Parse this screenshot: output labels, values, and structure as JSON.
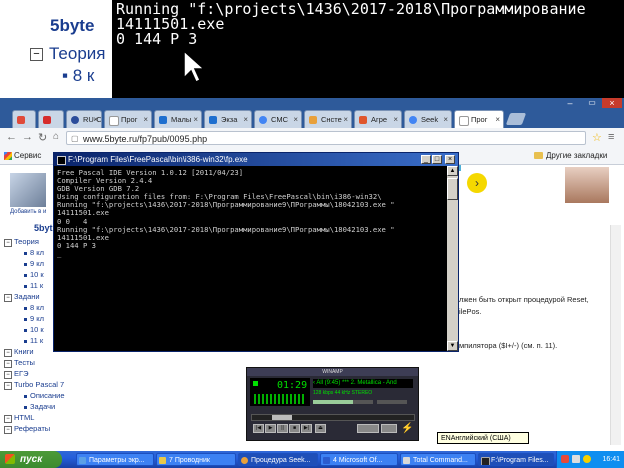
{
  "background": {
    "site_logo": "5byte",
    "tree_item": "Теория",
    "tree_sub": "8 к",
    "console_lines": [
      "Running \"f:\\projects\\1436\\2017-2018\\Программирование",
      "14111501.exe",
      "0 144 P 3"
    ]
  },
  "browser": {
    "tabs": [
      {
        "label": "",
        "color": "#e04a3a"
      },
      {
        "label": "",
        "color": "#d62c2c"
      },
      {
        "label": "RU-C",
        "color": "#2b4c9a"
      },
      {
        "label": "Прог",
        "color": "#ffffff"
      },
      {
        "label": "Малы",
        "color": "#1e6fcf"
      },
      {
        "label": "Экза",
        "color": "#1e6fcf"
      },
      {
        "label": "CMC",
        "color": "#4285f4"
      },
      {
        "label": "Снсте",
        "color": "#e8a03a"
      },
      {
        "label": "Агре",
        "color": "#e0562c"
      },
      {
        "label": "Seek",
        "color": "#4285f4"
      },
      {
        "label": "Прог",
        "color": "#ffffff"
      }
    ],
    "url": "www.5byte.ru/fp7pub/0095.php",
    "bookmarks_left": "Сервис",
    "bookmarks_right": "Другие закладки"
  },
  "sidebar": {
    "add_to_favorites": "Добавить в и",
    "logo": "5byt",
    "items": [
      {
        "label": "Теория",
        "type": "group"
      },
      {
        "label": "8 кл",
        "type": "sub"
      },
      {
        "label": "9 кл",
        "type": "sub"
      },
      {
        "label": "10 к",
        "type": "sub"
      },
      {
        "label": "11 к",
        "type": "sub"
      },
      {
        "label": "Задани",
        "type": "group"
      },
      {
        "label": "8 кл",
        "type": "sub"
      },
      {
        "label": "9 кл",
        "type": "sub"
      },
      {
        "label": "10 к",
        "type": "sub"
      },
      {
        "label": "11 к",
        "type": "sub"
      },
      {
        "label": "Книги",
        "type": "group"
      },
      {
        "label": "Тесты",
        "type": "group"
      },
      {
        "label": "ЕГЭ",
        "type": "group"
      },
      {
        "label": "Turbo Pascal 7",
        "type": "group"
      },
      {
        "label": "Описание",
        "type": "sub"
      },
      {
        "label": "Задачи",
        "type": "sub"
      },
      {
        "label": "HTML",
        "type": "group"
      },
      {
        "label": "Рефераты",
        "type": "group"
      }
    ]
  },
  "page_text": {
    "line1": "лжен быть открыт процедурой Reset,",
    "line2": "ilePos.",
    "line3": "мпилятора ($I+/-) (см. п. 11)."
  },
  "console": {
    "title": "F:\\Program Files\\FreePascal\\bin\\i386-win32\\fp.exe",
    "lines": [
      "Free Pascal IDE Version 1.0.12 [2011/04/23]",
      "Compiler Version 2.4.4",
      "GDB Version GDB 7.2",
      "Using configuration files from: F:\\Program Files\\FreePascal\\bin\\i386-win32\\",
      "Running \"f:\\projects\\1436\\2017-2018\\Программирование9\\ПРограммы\\18042103.exe \"",
      "14111501.exe",
      "0 0   4",
      "Running \"f:\\projects\\1436\\2017-2018\\Программирование9\\ПРограммы\\18042103.exe \"",
      "14111501.exe",
      "0 144 P 3",
      "_"
    ]
  },
  "winamp": {
    "title": "WINAMP",
    "time": "01:29",
    "song": "‹ All (9:45) *** 2. Metallica - And",
    "kbps": "128  kbps    44  kHz    STEREO"
  },
  "language_popup": "ENАнглийский (США)",
  "taskbar": {
    "start": "пуск",
    "tasks": [
      {
        "label": "Параметры экр...",
        "color": "#5aa0e6"
      },
      {
        "label": "7 Проводник",
        "color": "#e8c84a"
      },
      {
        "label": "Процедура Seek...",
        "color": "#e8a03a"
      },
      {
        "label": "4 Microsoft Of...",
        "color": "#2b5ccf"
      },
      {
        "label": "Total Command...",
        "color": "#d8d8d8"
      },
      {
        "label": "F:\\Program Files...",
        "color": "#222222"
      }
    ],
    "clock": "16:41"
  }
}
